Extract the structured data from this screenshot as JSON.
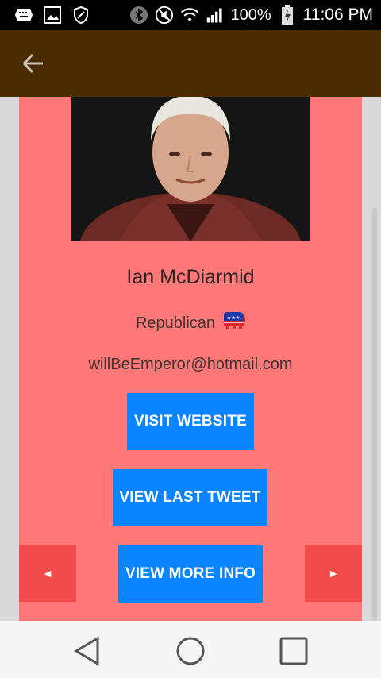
{
  "status_bar": {
    "battery_percent": "100%",
    "time": "11:06 PM",
    "icons": [
      "keyboard-icon",
      "image-icon",
      "shield-icon",
      "bluetooth-icon",
      "mute-icon",
      "wifi-icon",
      "signal-icon",
      "battery-charging-icon"
    ]
  },
  "app_bar": {
    "back_icon": "arrow-back-icon"
  },
  "profile": {
    "name": "Ian McDiarmid",
    "party": "Republican",
    "party_icon": "republican-elephant-icon",
    "email": "willBeEmperor@hotmail.com"
  },
  "actions": {
    "visit_website": "VISIT WEBSITE",
    "view_last_tweet": "VIEW LAST TWEET",
    "view_more_info": "VIEW MORE INFO",
    "prev": "◄",
    "next": "►"
  },
  "colors": {
    "app_bar": "#4b2c00",
    "card": "#ff7878",
    "button": "#0b84ff",
    "nav_button": "#f14b4b"
  },
  "nav_bar": {
    "icons": [
      "back-triangle-icon",
      "home-circle-icon",
      "recents-square-icon"
    ]
  }
}
